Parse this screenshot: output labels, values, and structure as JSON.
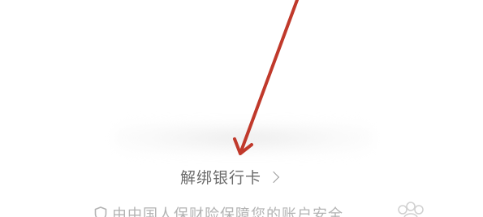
{
  "unbind": {
    "label": "解绑银行卡",
    "icon": "chevron-right-icon"
  },
  "footer": {
    "note": "由中国人保财险保障您的账户安全",
    "icon": "shield-icon",
    "partner_icon": "paw-icon"
  },
  "annotation": {
    "arrow_color": "#c0392b"
  }
}
